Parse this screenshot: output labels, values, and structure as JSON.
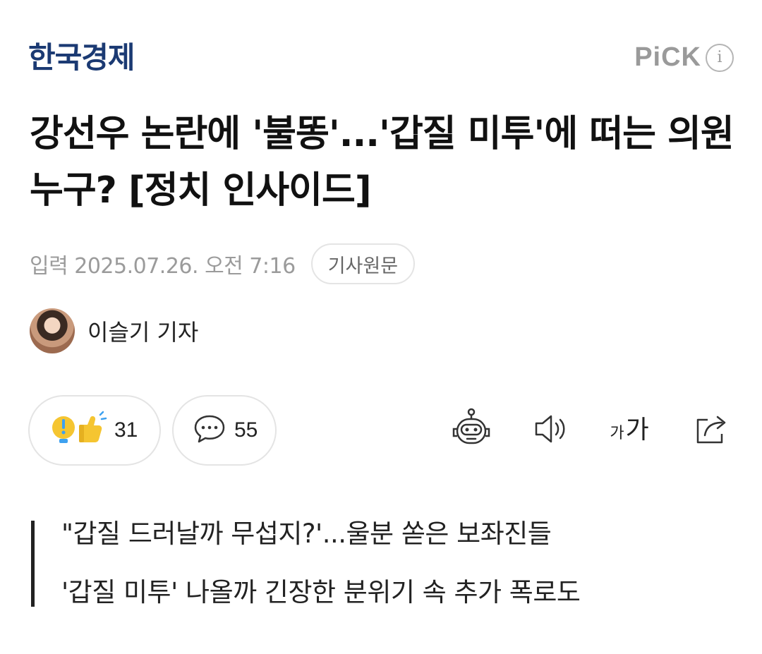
{
  "header": {
    "publisher": "한국경제",
    "pick_label": "PiCK",
    "info_icon": "info-icon"
  },
  "article": {
    "headline": "강선우 논란에 '불똥'...'갑질 미투'에 떠는 의원 누구? [정치 인사이드]",
    "published": "입력 2025.07.26. 오전 7:16",
    "original_link_label": "기사원문",
    "reporter": "이슬기 기자"
  },
  "actions": {
    "reaction_count": "31",
    "comment_count": "55",
    "icons": [
      "reaction-icon",
      "comment-icon",
      "robot-summary-icon",
      "speaker-icon",
      "font-size-icon",
      "share-icon"
    ],
    "font_size_label_small": "가",
    "font_size_label_large": "가"
  },
  "summary": {
    "lines": [
      "\"갑질 드러날까 무섭지?'...울분 쏟은 보좌진들",
      "'갑질 미투' 나올까 긴장한 분위기 속 추가 폭로도"
    ]
  },
  "colors": {
    "publisher_logo": "#1b3a73",
    "muted_text": "#9b9b9b",
    "border": "#e4e4e4",
    "reaction_yellow": "#f5c531",
    "reaction_blue": "#3ea1f0"
  }
}
